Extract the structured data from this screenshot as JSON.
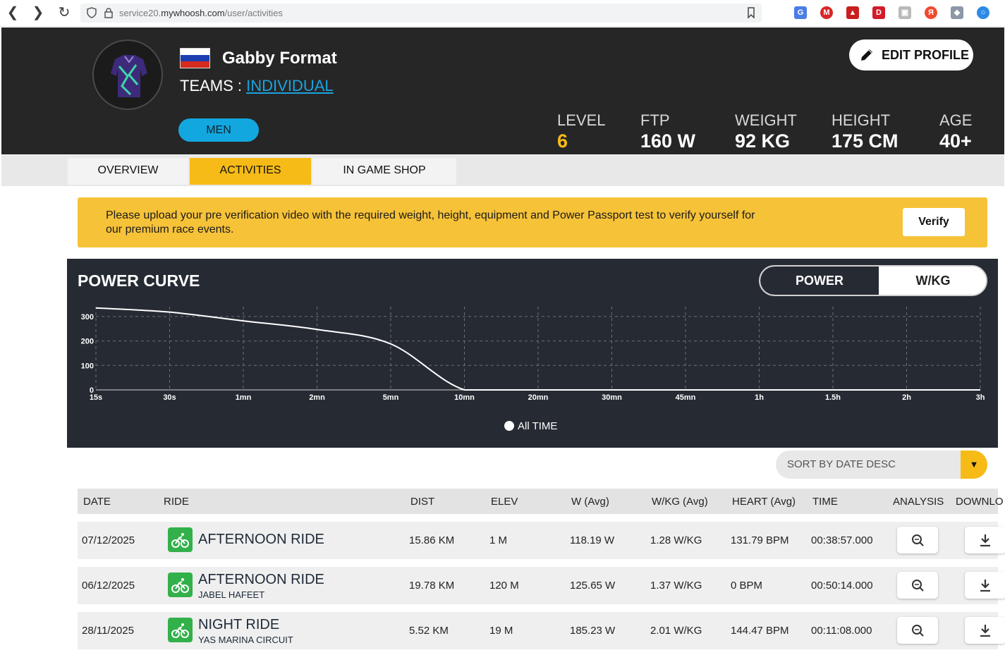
{
  "browser": {
    "url_prefix": "service20.",
    "url_domain": "mywhoosh.com",
    "url_path": "/user/activities"
  },
  "profile": {
    "name": "Gabby Format",
    "teams_label": "TEAMS :",
    "team": "INDIVIDUAL",
    "category": "MEN",
    "edit_label": "EDIT PROFILE",
    "stats": [
      {
        "label": "LEVEL",
        "value": "6",
        "color": "#f6bb16"
      },
      {
        "label": "FTP",
        "value": "160 W",
        "color": "#ffffff"
      },
      {
        "label": "WEIGHT",
        "value": "92 KG",
        "color": "#ffffff"
      },
      {
        "label": "HEIGHT",
        "value": "175 CM",
        "color": "#ffffff"
      },
      {
        "label": "AGE",
        "value": "40+",
        "color": "#ffffff"
      }
    ]
  },
  "tabs": [
    {
      "label": "OVERVIEW",
      "active": false
    },
    {
      "label": "ACTIVITIES",
      "active": true
    },
    {
      "label": "IN GAME SHOP",
      "active": false
    }
  ],
  "banner": {
    "text": "Please upload your pre verification video with the required weight, height, equipment and Power Passport test to verify yourself for our premium race events.",
    "button": "Verify"
  },
  "power_curve": {
    "title": "POWER CURVE",
    "toggle_power": "POWER",
    "toggle_wkg": "W/KG",
    "legend": "All TIME"
  },
  "chart_data": {
    "type": "line",
    "title": "POWER CURVE",
    "xlabel": "",
    "ylabel": "",
    "categories": [
      "15s",
      "30s",
      "1mn",
      "2mn",
      "5mn",
      "10mn",
      "20mn",
      "30mn",
      "45mn",
      "1h",
      "1.5h",
      "2h",
      "3h"
    ],
    "y_ticks": [
      "0",
      "100",
      "200",
      "300"
    ],
    "ylim": [
      0,
      340
    ],
    "series": [
      {
        "name": "All TIME",
        "values": [
          335,
          318,
          282,
          247,
          188,
          0,
          0,
          0,
          0,
          0,
          0,
          0,
          0
        ]
      }
    ],
    "grid": true,
    "line_color": "#ffffff"
  },
  "sort": {
    "label": "SORT BY DATE DESC"
  },
  "table": {
    "headers": [
      "DATE",
      "RIDE",
      "DIST",
      "ELEV",
      "W (Avg)",
      "W/KG (Avg)",
      "HEART (Avg)",
      "TIME",
      "ANALYSIS",
      "DOWNLO"
    ],
    "rows": [
      {
        "date": "07/12/2025",
        "ride": "AFTERNOON RIDE",
        "route": "",
        "dist": "15.86 KM",
        "elev": "1 M",
        "w": "118.19 W",
        "wkg": "1.28 W/KG",
        "heart": "131.79 BPM",
        "time": "00:38:57.000"
      },
      {
        "date": "06/12/2025",
        "ride": "AFTERNOON RIDE",
        "route": "JABEL HAFEET",
        "dist": "19.78 KM",
        "elev": "120 M",
        "w": "125.65 W",
        "wkg": "1.37 W/KG",
        "heart": "0 BPM",
        "time": "00:50:14.000"
      },
      {
        "date": "28/11/2025",
        "ride": "NIGHT RIDE",
        "route": "YAS MARINA CIRCUIT",
        "dist": "5.52 KM",
        "elev": "19 M",
        "w": "185.23 W",
        "wkg": "2.01 W/KG",
        "heart": "144.47 BPM",
        "time": "00:11:08.000"
      }
    ]
  }
}
